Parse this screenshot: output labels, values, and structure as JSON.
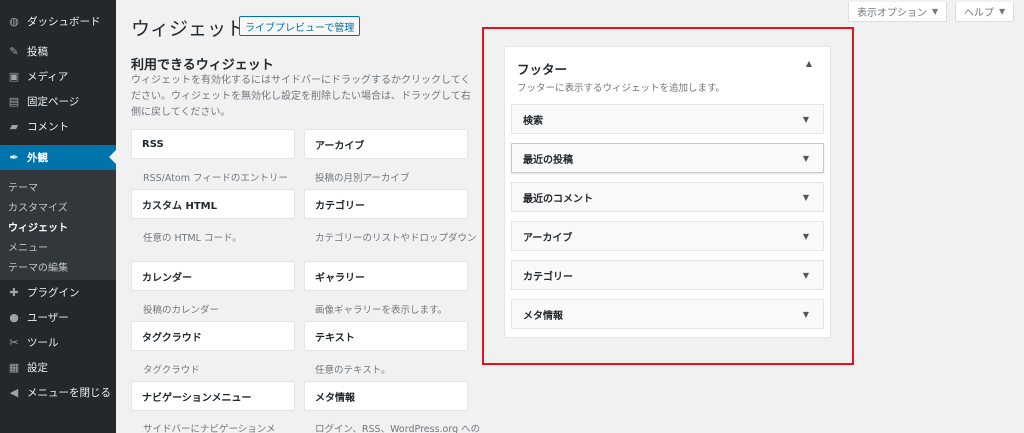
{
  "sidebar": {
    "items": [
      {
        "icon": "dashboard-icon",
        "glyph": "◍",
        "label": "ダッシュボード"
      },
      {
        "icon": "pin-icon",
        "glyph": "✎",
        "label": "投稿"
      },
      {
        "icon": "media-icon",
        "glyph": "▣",
        "label": "メディア"
      },
      {
        "icon": "page-icon",
        "glyph": "▤",
        "label": "固定ページ"
      },
      {
        "icon": "comment-icon",
        "glyph": "▰",
        "label": "コメント"
      },
      {
        "icon": "paintbrush-icon",
        "glyph": "✒",
        "label": "外観"
      }
    ],
    "submenu": [
      "テーマ",
      "カスタマイズ",
      "ウィジェット",
      "メニュー",
      "テーマの編集"
    ],
    "items_after": [
      {
        "icon": "plugin-icon",
        "glyph": "✚",
        "label": "プラグイン"
      },
      {
        "icon": "user-icon",
        "glyph": "●",
        "label": "ユーザー"
      },
      {
        "icon": "wrench-icon",
        "glyph": "✂",
        "label": "ツール"
      },
      {
        "icon": "settings-icon",
        "glyph": "▦",
        "label": "設定"
      },
      {
        "icon": "collapse-icon",
        "glyph": "◀",
        "label": "メニューを閉じる"
      }
    ]
  },
  "top": {
    "screen_options": "表示オプション",
    "help": "ヘルプ"
  },
  "page": {
    "title": "ウィジェット",
    "live_preview": "ライブプレビューで管理"
  },
  "available": {
    "title": "利用できるウィジェット",
    "desc": "ウィジェットを有効化するにはサイドバーにドラッグするかクリックしてください。ウィジェットを無効化し設定を削除したい場合は、ドラッグして右側に戻してください。",
    "widgets": [
      {
        "name": "RSS",
        "desc": "RSS/Atom フィードのエントリー"
      },
      {
        "name": "アーカイブ",
        "desc": "投稿の月別アーカイブ"
      },
      {
        "name": "カスタム HTML",
        "desc": "任意の HTML コード。"
      },
      {
        "name": "カテゴリー",
        "desc": "カテゴリーのリストやドロップダウン"
      },
      {
        "name": "カレンダー",
        "desc": "投稿のカレンダー"
      },
      {
        "name": "ギャラリー",
        "desc": "画像ギャラリーを表示します。"
      },
      {
        "name": "タグクラウド",
        "desc": "タグクラウド"
      },
      {
        "name": "テキスト",
        "desc": "任意のテキスト。"
      },
      {
        "name": "ナビゲーションメニュー",
        "desc": "サイドバーにナビゲーションメ"
      },
      {
        "name": "メタ情報",
        "desc": "ログイン、RSS、WordPress.org への"
      }
    ]
  },
  "footer_area": {
    "title": "フッター",
    "desc": "フッターに表示するウィジェットを追加します。",
    "widgets": [
      "検索",
      "最近の投稿",
      "最近のコメント",
      "アーカイブ",
      "カテゴリー",
      "メタ情報"
    ]
  },
  "colors": {
    "accent": "#0073aa",
    "highlight_frame": "#e0141e",
    "sidebar_bg": "#23282d"
  }
}
